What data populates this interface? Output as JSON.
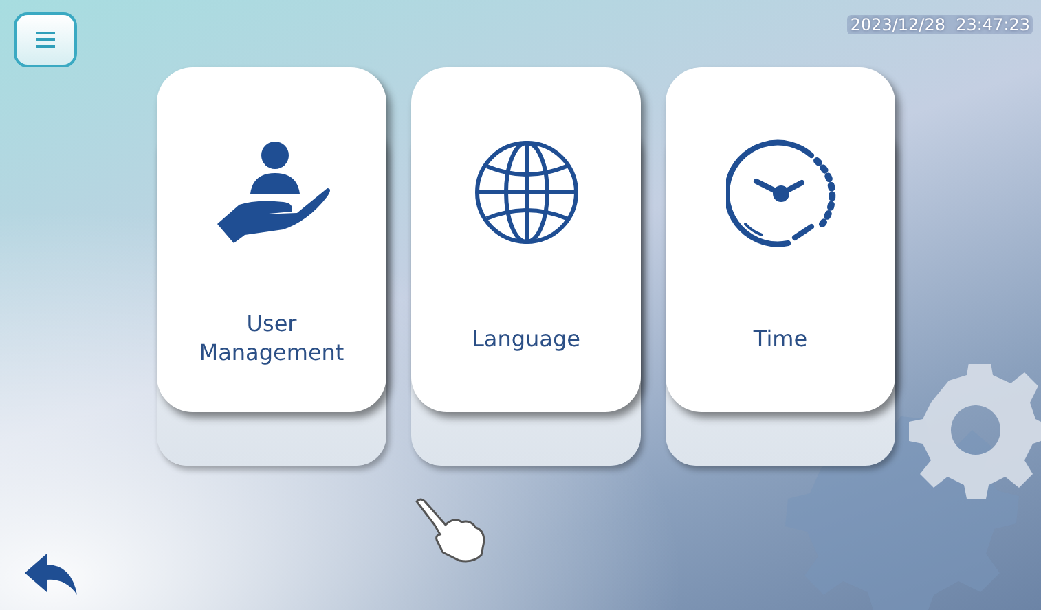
{
  "status_bar": {
    "datetime": "2023/12/28  23:47:23"
  },
  "tiles": [
    {
      "label": "User Management",
      "kind": "user"
    },
    {
      "label": "Language",
      "kind": "globe"
    },
    {
      "label": "Time",
      "kind": "clock"
    }
  ]
}
